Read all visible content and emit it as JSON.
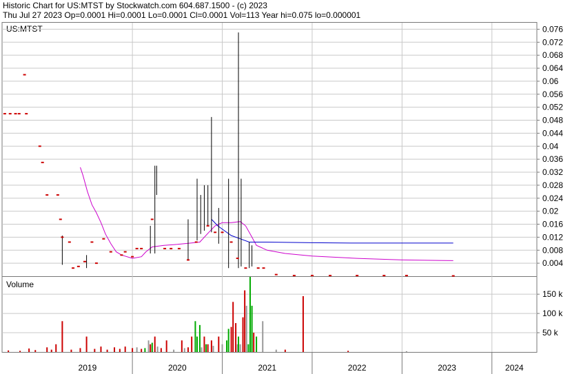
{
  "header": {
    "line1": "Historic Chart for US:MTST by Stockwatch.com 604.687.1500 - (c) 2023",
    "line2": "Thu Jul 27 2023   Op=0.0001   Hi=0.0001   Lo=0.0001   Cl=0.0001   Vol=113   Year hi=0.075   lo=0.000001"
  },
  "chart_data": [
    {
      "type": "line",
      "title": "US:MTST",
      "y_ticks": [
        "0.004",
        "0.008",
        "0.012",
        "0.016",
        "0.02",
        "0.024",
        "0.028",
        "0.032",
        "0.036",
        "0.04",
        "0.044",
        "0.048",
        "0.052",
        "0.056",
        "0.06",
        "0.064",
        "0.068",
        "0.072",
        "0.076"
      ],
      "ylim": [
        0,
        0.078
      ],
      "x_ticks": [
        "2019",
        "2020",
        "2021",
        "2022",
        "2023",
        "2024"
      ],
      "grid": true,
      "colors": {
        "price": "#cc0000",
        "bar": "#000000",
        "ma_long": "#0000cc",
        "ma_short": "#cc00cc",
        "grid": "#c8c8c8"
      },
      "price_points": [
        {
          "x": 2018.58,
          "y": 0.05
        },
        {
          "x": 2018.64,
          "y": 0.05
        },
        {
          "x": 2018.7,
          "y": 0.05
        },
        {
          "x": 2018.74,
          "y": 0.05
        },
        {
          "x": 2018.8,
          "y": 0.062
        },
        {
          "x": 2018.82,
          "y": 0.05
        },
        {
          "x": 2018.97,
          "y": 0.04
        },
        {
          "x": 2019.0,
          "y": 0.035
        },
        {
          "x": 2019.05,
          "y": 0.025
        },
        {
          "x": 2019.17,
          "y": 0.025
        },
        {
          "x": 2019.2,
          "y": 0.0175
        },
        {
          "x": 2019.22,
          "y": 0.012
        },
        {
          "x": 2019.3,
          "y": 0.0105
        },
        {
          "x": 2019.34,
          "y": 0.0025
        },
        {
          "x": 2019.4,
          "y": 0.003
        },
        {
          "x": 2019.47,
          "y": 0.0045
        },
        {
          "x": 2019.55,
          "y": 0.0105
        },
        {
          "x": 2019.6,
          "y": 0.004
        },
        {
          "x": 2019.68,
          "y": 0.0115
        },
        {
          "x": 2019.76,
          "y": 0.0075
        },
        {
          "x": 2019.88,
          "y": 0.0065
        },
        {
          "x": 2019.92,
          "y": 0.0075
        },
        {
          "x": 2020.0,
          "y": 0.006
        },
        {
          "x": 2020.05,
          "y": 0.0085
        },
        {
          "x": 2020.1,
          "y": 0.0085
        },
        {
          "x": 2020.22,
          "y": 0.0175
        },
        {
          "x": 2020.36,
          "y": 0.0085
        },
        {
          "x": 2020.43,
          "y": 0.0085
        },
        {
          "x": 2020.52,
          "y": 0.0085
        },
        {
          "x": 2020.62,
          "y": 0.005
        },
        {
          "x": 2020.71,
          "y": 0.0105
        },
        {
          "x": 2020.84,
          "y": 0.0155
        },
        {
          "x": 2020.92,
          "y": 0.0135
        },
        {
          "x": 2021.0,
          "y": 0.0135
        },
        {
          "x": 2021.1,
          "y": 0.0105
        },
        {
          "x": 2021.17,
          "y": 0.0055
        },
        {
          "x": 2021.26,
          "y": 0.0025
        },
        {
          "x": 2021.4,
          "y": 0.0025
        },
        {
          "x": 2021.46,
          "y": 0.0025
        },
        {
          "x": 2021.6,
          "y": 0.0005
        },
        {
          "x": 2021.8,
          "y": 0.0002
        },
        {
          "x": 2022.0,
          "y": 0.0002
        },
        {
          "x": 2022.2,
          "y": 0.0002
        },
        {
          "x": 2022.5,
          "y": 0.0002
        },
        {
          "x": 2022.8,
          "y": 0.0002
        },
        {
          "x": 2023.05,
          "y": 0.0002
        },
        {
          "x": 2023.57,
          "y": 0.0001
        }
      ],
      "range_bars": [
        {
          "x": 2019.22,
          "lo": 0.0035,
          "hi": 0.0125
        },
        {
          "x": 2019.49,
          "lo": 0.0025,
          "hi": 0.0065
        },
        {
          "x": 2020.2,
          "lo": 0.007,
          "hi": 0.0155
        },
        {
          "x": 2020.25,
          "lo": 0.007,
          "hi": 0.034
        },
        {
          "x": 2020.27,
          "lo": 0.025,
          "hi": 0.034
        },
        {
          "x": 2020.62,
          "lo": 0.005,
          "hi": 0.0175
        },
        {
          "x": 2020.72,
          "lo": 0.011,
          "hi": 0.03
        },
        {
          "x": 2020.76,
          "lo": 0.013,
          "hi": 0.025
        },
        {
          "x": 2020.8,
          "lo": 0.014,
          "hi": 0.028
        },
        {
          "x": 2020.84,
          "lo": 0.0155,
          "hi": 0.028
        },
        {
          "x": 2020.88,
          "lo": 0.0135,
          "hi": 0.049
        },
        {
          "x": 2020.96,
          "lo": 0.01,
          "hi": 0.021
        },
        {
          "x": 2021.07,
          "lo": 0.0025,
          "hi": 0.03
        },
        {
          "x": 2021.18,
          "lo": 0.0025,
          "hi": 0.075
        },
        {
          "x": 2021.21,
          "lo": 0.003,
          "hi": 0.03
        },
        {
          "x": 2021.3,
          "lo": 0.0025,
          "hi": 0.0105
        },
        {
          "x": 2021.33,
          "lo": 0.003,
          "hi": 0.0095
        }
      ],
      "ma_long": [
        {
          "x": 2020.88,
          "y": 0.0175
        },
        {
          "x": 2020.95,
          "y": 0.0155
        },
        {
          "x": 2021.0,
          "y": 0.0145
        },
        {
          "x": 2021.1,
          "y": 0.0125
        },
        {
          "x": 2021.2,
          "y": 0.0115
        },
        {
          "x": 2021.3,
          "y": 0.0105
        },
        {
          "x": 2021.5,
          "y": 0.0105
        },
        {
          "x": 2022.0,
          "y": 0.0103
        },
        {
          "x": 2022.5,
          "y": 0.0102
        },
        {
          "x": 2023.0,
          "y": 0.0102
        },
        {
          "x": 2023.57,
          "y": 0.0102
        }
      ],
      "ma_short": [
        {
          "x": 2019.42,
          "y": 0.0335
        },
        {
          "x": 2019.45,
          "y": 0.031
        },
        {
          "x": 2019.5,
          "y": 0.026
        },
        {
          "x": 2019.55,
          "y": 0.022
        },
        {
          "x": 2019.6,
          "y": 0.0195
        },
        {
          "x": 2019.65,
          "y": 0.0165
        },
        {
          "x": 2019.7,
          "y": 0.013
        },
        {
          "x": 2019.76,
          "y": 0.01
        },
        {
          "x": 2019.82,
          "y": 0.0075
        },
        {
          "x": 2019.88,
          "y": 0.0065
        },
        {
          "x": 2020.0,
          "y": 0.0055
        },
        {
          "x": 2020.1,
          "y": 0.006
        },
        {
          "x": 2020.15,
          "y": 0.0075
        },
        {
          "x": 2020.22,
          "y": 0.009
        },
        {
          "x": 2020.35,
          "y": 0.0095
        },
        {
          "x": 2020.5,
          "y": 0.0098
        },
        {
          "x": 2020.65,
          "y": 0.0102
        },
        {
          "x": 2020.75,
          "y": 0.0105
        },
        {
          "x": 2020.85,
          "y": 0.0135
        },
        {
          "x": 2020.92,
          "y": 0.0155
        },
        {
          "x": 2021.0,
          "y": 0.0165
        },
        {
          "x": 2021.1,
          "y": 0.0165
        },
        {
          "x": 2021.2,
          "y": 0.0168
        },
        {
          "x": 2021.26,
          "y": 0.0155
        },
        {
          "x": 2021.32,
          "y": 0.0125
        },
        {
          "x": 2021.38,
          "y": 0.0095
        },
        {
          "x": 2021.5,
          "y": 0.008
        },
        {
          "x": 2021.7,
          "y": 0.007
        },
        {
          "x": 2022.0,
          "y": 0.0062
        },
        {
          "x": 2022.5,
          "y": 0.0055
        },
        {
          "x": 2023.0,
          "y": 0.005
        },
        {
          "x": 2023.57,
          "y": 0.0048
        }
      ]
    },
    {
      "type": "bar",
      "title": "Volume",
      "y_ticks": [
        "50 k",
        "100 k",
        "150 k"
      ],
      "ylim": [
        0,
        195000
      ],
      "x_ticks": [
        "2019",
        "2020",
        "2021",
        "2022",
        "2023",
        "2024"
      ],
      "grid": true,
      "colors": {
        "up": "#cc0000",
        "down": "#00aa00",
        "flat": "#999999"
      },
      "bars": [
        {
          "x": 2018.62,
          "v": 4000,
          "c": "up"
        },
        {
          "x": 2018.75,
          "v": 3000,
          "c": "up"
        },
        {
          "x": 2018.85,
          "v": 9000,
          "c": "up"
        },
        {
          "x": 2018.92,
          "v": 5000,
          "c": "up"
        },
        {
          "x": 2019.05,
          "v": 12000,
          "c": "up"
        },
        {
          "x": 2019.1,
          "v": 6000,
          "c": "up"
        },
        {
          "x": 2019.15,
          "v": 20000,
          "c": "up"
        },
        {
          "x": 2019.22,
          "v": 80000,
          "c": "up"
        },
        {
          "x": 2019.32,
          "v": 6000,
          "c": "up"
        },
        {
          "x": 2019.42,
          "v": 10000,
          "c": "up"
        },
        {
          "x": 2019.49,
          "v": 40000,
          "c": "up"
        },
        {
          "x": 2019.58,
          "v": 8000,
          "c": "up"
        },
        {
          "x": 2019.65,
          "v": 14000,
          "c": "up"
        },
        {
          "x": 2019.72,
          "v": 6000,
          "c": "up"
        },
        {
          "x": 2019.8,
          "v": 12000,
          "c": "up"
        },
        {
          "x": 2019.86,
          "v": 8000,
          "c": "up"
        },
        {
          "x": 2019.92,
          "v": 14000,
          "c": "up"
        },
        {
          "x": 2020.0,
          "v": 10000,
          "c": "up"
        },
        {
          "x": 2020.05,
          "v": 12000,
          "c": "flat"
        },
        {
          "x": 2020.1,
          "v": 8000,
          "c": "up"
        },
        {
          "x": 2020.14,
          "v": 10000,
          "c": "down"
        },
        {
          "x": 2020.18,
          "v": 30000,
          "c": "flat"
        },
        {
          "x": 2020.2,
          "v": 20000,
          "c": "up"
        },
        {
          "x": 2020.22,
          "v": 24000,
          "c": "down"
        },
        {
          "x": 2020.25,
          "v": 40000,
          "c": "up"
        },
        {
          "x": 2020.28,
          "v": 14000,
          "c": "flat"
        },
        {
          "x": 2020.32,
          "v": 10000,
          "c": "up"
        },
        {
          "x": 2020.38,
          "v": 30000,
          "c": "up"
        },
        {
          "x": 2020.46,
          "v": 6000,
          "c": "flat"
        },
        {
          "x": 2020.55,
          "v": 30000,
          "c": "up"
        },
        {
          "x": 2020.58,
          "v": 10000,
          "c": "flat"
        },
        {
          "x": 2020.62,
          "v": 12000,
          "c": "up"
        },
        {
          "x": 2020.66,
          "v": 40000,
          "c": "up"
        },
        {
          "x": 2020.7,
          "v": 80000,
          "c": "down"
        },
        {
          "x": 2020.72,
          "v": 40000,
          "c": "down"
        },
        {
          "x": 2020.75,
          "v": 70000,
          "c": "down"
        },
        {
          "x": 2020.77,
          "v": 12000,
          "c": "flat"
        },
        {
          "x": 2020.8,
          "v": 40000,
          "c": "up"
        },
        {
          "x": 2020.82,
          "v": 20000,
          "c": "down"
        },
        {
          "x": 2020.84,
          "v": 20000,
          "c": "up"
        },
        {
          "x": 2020.88,
          "v": 30000,
          "c": "up"
        },
        {
          "x": 2020.9,
          "v": 16000,
          "c": "flat"
        },
        {
          "x": 2020.96,
          "v": 40000,
          "c": "up"
        },
        {
          "x": 2021.0,
          "v": 20000,
          "c": "flat"
        },
        {
          "x": 2021.05,
          "v": 30000,
          "c": "down"
        },
        {
          "x": 2021.07,
          "v": 60000,
          "c": "down"
        },
        {
          "x": 2021.1,
          "v": 65000,
          "c": "up"
        },
        {
          "x": 2021.12,
          "v": 130000,
          "c": "up"
        },
        {
          "x": 2021.15,
          "v": 75000,
          "c": "up"
        },
        {
          "x": 2021.17,
          "v": 20000,
          "c": "flat"
        },
        {
          "x": 2021.18,
          "v": 40000,
          "c": "down"
        },
        {
          "x": 2021.2,
          "v": 20000,
          "c": "flat"
        },
        {
          "x": 2021.23,
          "v": 90000,
          "c": "up"
        },
        {
          "x": 2021.25,
          "v": 160000,
          "c": "up"
        },
        {
          "x": 2021.27,
          "v": 120000,
          "c": "flat"
        },
        {
          "x": 2021.29,
          "v": 20000,
          "c": "down"
        },
        {
          "x": 2021.31,
          "v": 195000,
          "c": "down"
        },
        {
          "x": 2021.33,
          "v": 120000,
          "c": "down"
        },
        {
          "x": 2021.35,
          "v": 50000,
          "c": "up"
        },
        {
          "x": 2021.38,
          "v": 40000,
          "c": "down"
        },
        {
          "x": 2021.45,
          "v": 80000,
          "c": "flat"
        },
        {
          "x": 2021.6,
          "v": 6000,
          "c": "flat"
        },
        {
          "x": 2021.7,
          "v": 6000,
          "c": "up"
        },
        {
          "x": 2021.9,
          "v": 145000,
          "c": "up"
        },
        {
          "x": 2022.4,
          "v": 3000,
          "c": "up"
        },
        {
          "x": 2023.05,
          "v": 2000,
          "c": "flat"
        }
      ]
    }
  ]
}
